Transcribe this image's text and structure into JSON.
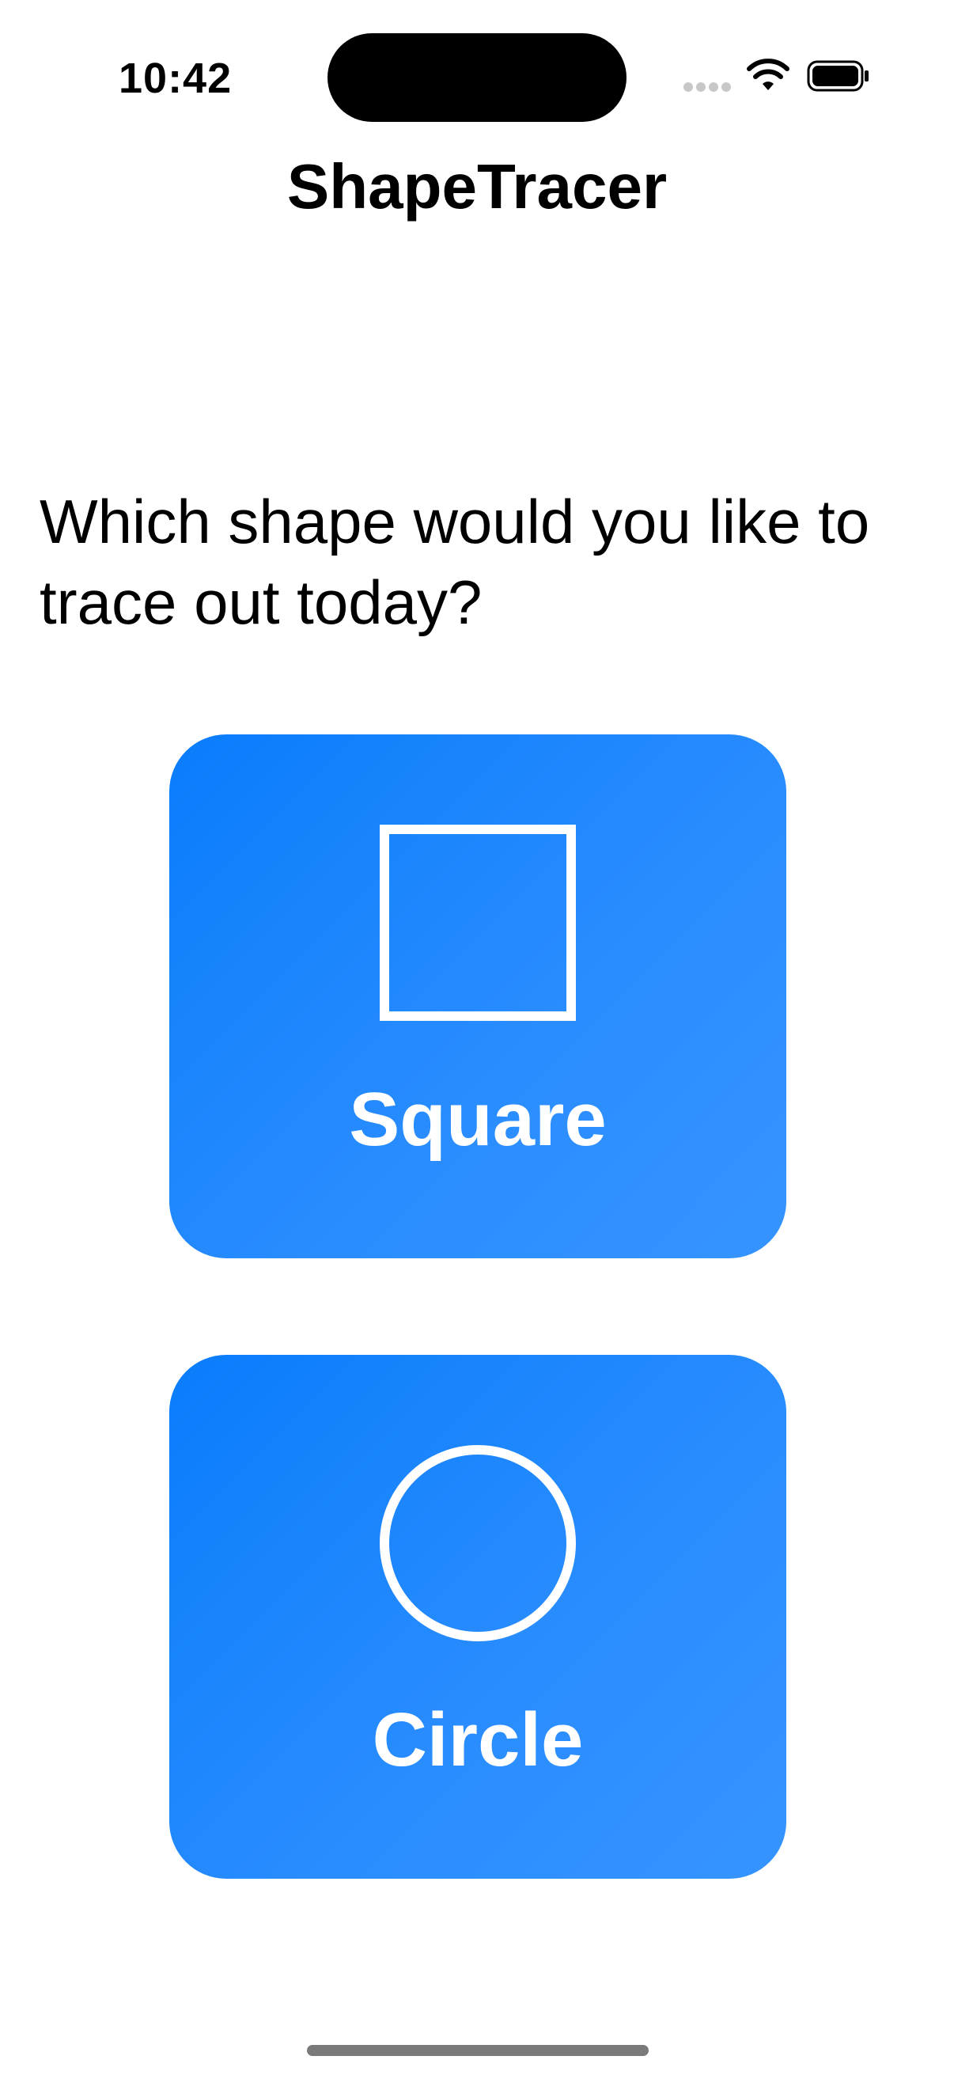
{
  "status_bar": {
    "time": "10:42",
    "icons": [
      "cellular-signal-icon",
      "wifi-icon",
      "battery-icon"
    ]
  },
  "nav": {
    "title": "ShapeTracer"
  },
  "prompt": "Which shape would you like to trace out today?",
  "shapes": [
    {
      "label": "Square",
      "icon": "square-outline-icon"
    },
    {
      "label": "Circle",
      "icon": "circle-outline-icon"
    }
  ],
  "colors": {
    "card_gradient_start": "#0a7cfb",
    "card_gradient_end": "#3594ff",
    "card_text": "#ffffff",
    "background": "#ffffff"
  }
}
